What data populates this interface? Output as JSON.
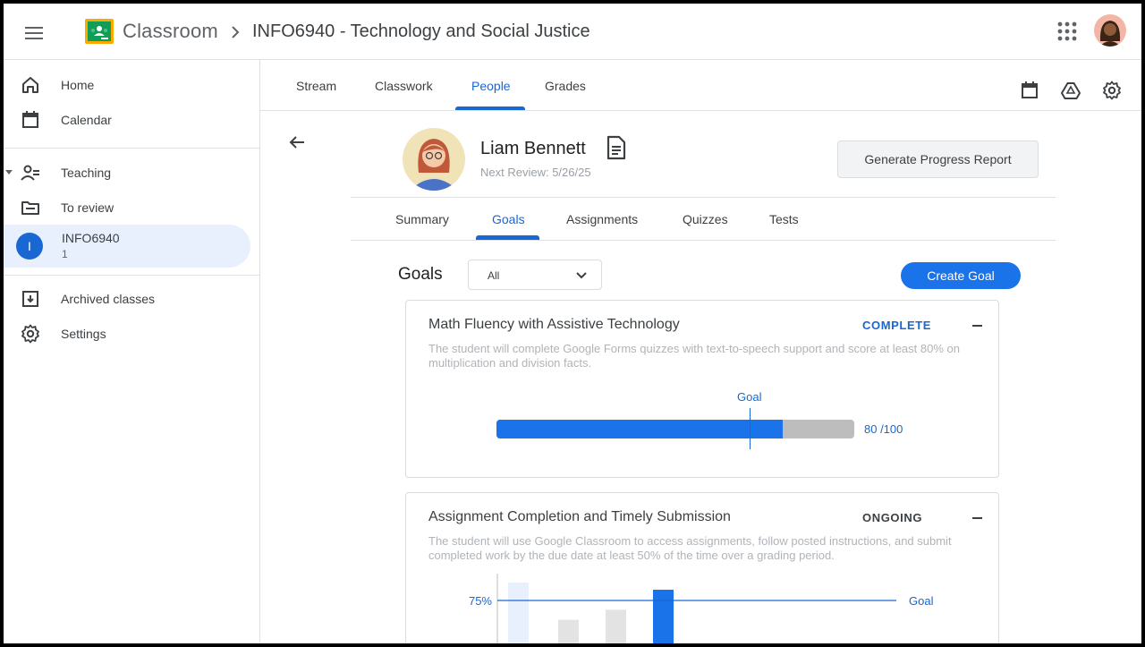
{
  "header": {
    "app_title": "Classroom",
    "class_title": "INFO6940 - Technology and Social Justice"
  },
  "sidebar": {
    "items": [
      {
        "label": "Home",
        "icon": "home-icon"
      },
      {
        "label": "Calendar",
        "icon": "calendar-icon"
      },
      {
        "label": "Teaching",
        "icon": "teaching-icon"
      },
      {
        "label": "To review",
        "icon": "to-review-icon"
      },
      {
        "label": "Archived classes",
        "icon": "archive-icon"
      },
      {
        "label": "Settings",
        "icon": "gear-icon"
      }
    ],
    "active_class": {
      "initial": "I",
      "name": "INFO6940",
      "sub": "1"
    }
  },
  "class_tabs": {
    "stream": "Stream",
    "classwork": "Classwork",
    "people": "People",
    "grades": "Grades",
    "active": "People"
  },
  "student": {
    "name": "Liam Bennett",
    "next_review": "Next Review: 5/26/25",
    "report_button": "Generate Progress Report"
  },
  "sub_tabs": {
    "summary": "Summary",
    "goals": "Goals",
    "assignments": "Assignments",
    "quizzes": "Quizzes",
    "tests": "Tests",
    "active": "Goals"
  },
  "goals_section": {
    "heading": "Goals",
    "filter_value": "All",
    "create_button": "Create Goal"
  },
  "goals": [
    {
      "title": "Math Fluency with Assistive Technology",
      "status": "COMPLETE",
      "status_color": "#1967d2",
      "description": "The student will complete Google Forms quizzes with text-to-speech support and score at least 80% on multiplication and division facts.",
      "goal_label": "Goal",
      "progress_value": 80,
      "progress_max": 100,
      "progress_text": "80 /100"
    },
    {
      "title": "Assignment Completion and Timely Submission",
      "status": "ONGOING",
      "status_color": "#3c4043",
      "description": "The student will use Google Classroom to access assignments, follow posted instructions, and submit completed work by the due date at least 50% of the time over a grading period.",
      "chart_data": {
        "type": "bar",
        "ytick_label": "75%",
        "goal_label": "Goal",
        "goal_value": 75,
        "values": [
          100,
          48,
          62,
          90
        ],
        "colors": [
          "#e8f0fe",
          "#e3e3e3",
          "#e3e3e3",
          "#1a73e8"
        ]
      }
    }
  ],
  "colors": {
    "accent": "#1a73e8",
    "active_nav_bg": "#e8f0fe"
  }
}
